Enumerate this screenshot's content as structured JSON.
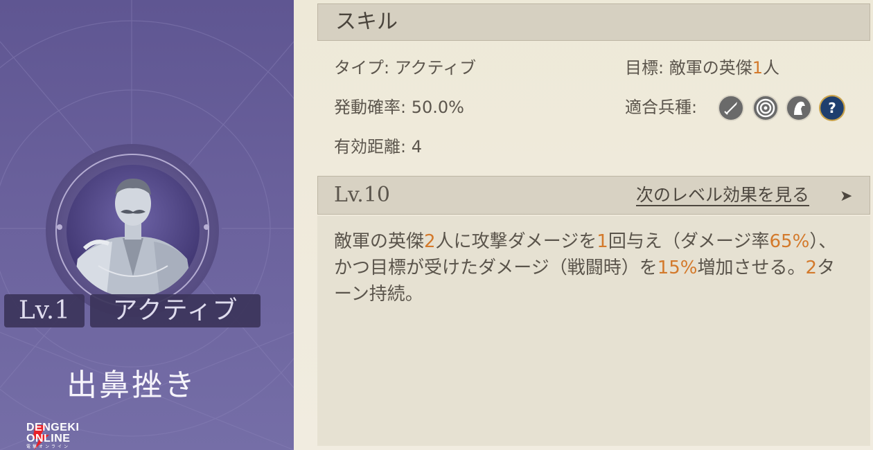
{
  "hero": {
    "level": "Lv.1",
    "skill_type": "アクティブ",
    "skill_name": "出鼻挫き"
  },
  "watermark": {
    "line1": "DENGEKI",
    "line2": "ONLINE",
    "line3": "電撃オンライン"
  },
  "skill": {
    "header": "スキル",
    "type_label": "タイプ: アクティブ",
    "activation_rate": "発動確率: 50.0%",
    "effective_range": "有効距離: 4",
    "target_prefix": "目標: 敵軍の英傑",
    "target_count": "1",
    "target_suffix": "人",
    "unit_types_label": "適合兵種:",
    "unit_types": [
      "sword-icon",
      "bow-target-icon",
      "horse-icon",
      "question-icon"
    ]
  },
  "level_section": {
    "level": "Lv.10",
    "next_level_link": "次のレベル効果を見る",
    "arrow": "➤"
  },
  "description": {
    "p1": "敵軍の英傑",
    "n1": "2",
    "p2": "人に攻撃ダメージを",
    "n2": "1",
    "p3": "回与え（ダメージ率",
    "n3": "65%",
    "p4": "）、かつ目標が受けたダメージ（戦闘時）を",
    "n4": "15%",
    "p5": "増加させる。",
    "n5": "2",
    "p6": "ターン持続。"
  },
  "colors": {
    "highlight": "#d3792b",
    "panel_purple": "#6a619c",
    "parchment": "#efeadb"
  }
}
